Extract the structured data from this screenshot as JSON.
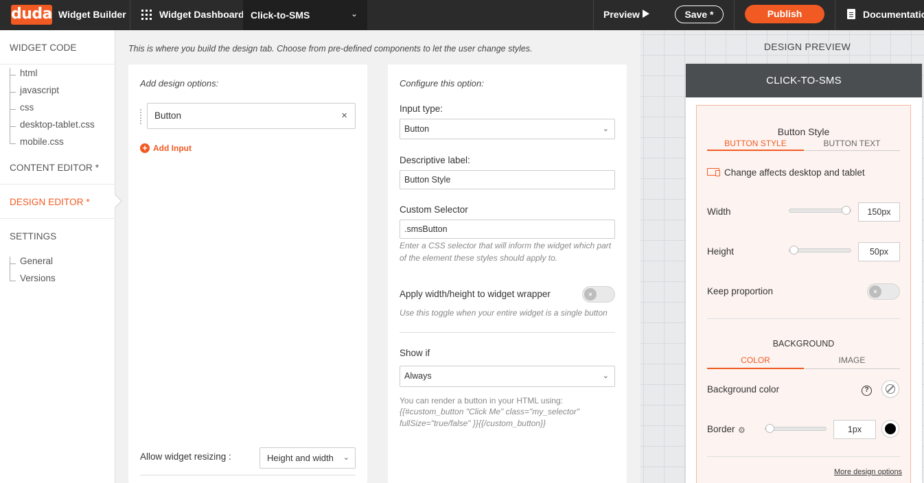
{
  "topbar": {
    "logo": "duda",
    "app_name": "Widget Builder",
    "dashboard": "Widget Dashboard",
    "widget_select": "Click-to-SMS",
    "preview": "Preview",
    "save": "Save *",
    "publish": "Publish",
    "documentation": "Documentation"
  },
  "sidebar": {
    "widget_code": "WIDGET CODE",
    "code_files": [
      "html",
      "javascript",
      "css",
      "desktop-tablet.css",
      "mobile.css"
    ],
    "content_editor": "CONTENT EDITOR *",
    "design_editor": "DESIGN EDITOR *",
    "settings": "SETTINGS",
    "settings_items": [
      "General",
      "Versions"
    ]
  },
  "main": {
    "intro": "This is where you build the design tab. Choose from pre-defined components to let the user change styles."
  },
  "add_options": {
    "title": "Add design options:",
    "item_label": "Button",
    "add_input": "Add Input",
    "resize_label": "Allow widget resizing :",
    "resize_value": "Height and width"
  },
  "configure": {
    "title": "Configure this option:",
    "input_type_label": "Input type:",
    "input_type_value": "Button",
    "desc_label": "Descriptive label:",
    "desc_value": "Button Style",
    "selector_label": "Custom Selector",
    "selector_value": ".smsButton",
    "selector_hint": "Enter a CSS selector that will inform the widget which part of the element these styles should apply to.",
    "wrapper_label": "Apply width/height to widget wrapper",
    "wrapper_hint": "Use this toggle when your entire widget is a single button",
    "wrapper_on": false,
    "show_if_label": "Show if",
    "show_if_value": "Always",
    "render_hint": "You can render a button in your HTML using:",
    "render_code": "{{#custom_button \"Click Me\" class=\"my_selector\" fullSize=\"true/false\" }}{{/custom_button}}"
  },
  "preview": {
    "title": "DESIGN PREVIEW",
    "widget_title": "CLICK-TO-SMS",
    "section_title": "Button Style",
    "tabs": [
      "BUTTON STYLE",
      "BUTTON TEXT"
    ],
    "device_note": "Change affects desktop and tablet",
    "width_label": "Width",
    "width_value": "150px",
    "width_level": 1.0,
    "height_label": "Height",
    "height_value": "50px",
    "height_level": 0.0,
    "keep_label": "Keep proportion",
    "keep_on": false,
    "background_title": "BACKGROUND",
    "bg_tabs": [
      "COLOR",
      "IMAGE"
    ],
    "bg_color_label": "Background color",
    "border_label": "Border",
    "border_value": "1px",
    "border_level": 0.0,
    "border_color": "#000000",
    "more_link": "More design options"
  },
  "colors": {
    "accent": "#f15a22",
    "topbar": "#2b2b2b"
  }
}
